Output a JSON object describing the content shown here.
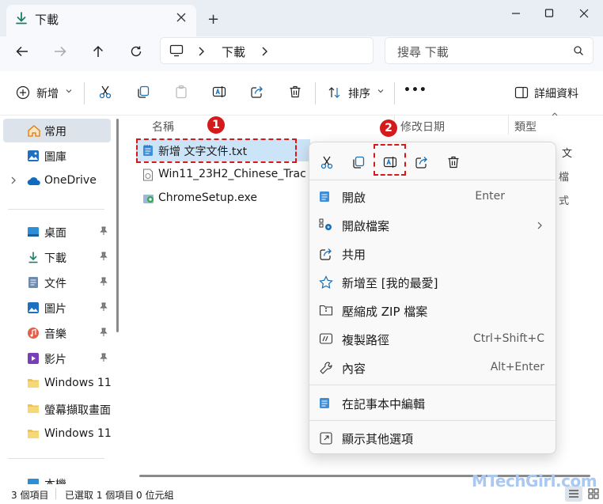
{
  "window": {
    "tab_title": "下載",
    "new_tab_symbol": "+"
  },
  "address_bar": {
    "crumbs": [
      "下載"
    ],
    "search_placeholder": "搜尋 下載"
  },
  "toolbar": {
    "new_label": "新增",
    "sort_label": "排序",
    "more_label": "•••",
    "details_label": "詳細資料"
  },
  "nav": {
    "home": "常用",
    "gallery": "圖庫",
    "onedrive": "OneDrive",
    "desktop": "桌面",
    "downloads": "下載",
    "documents": "文件",
    "pictures": "圖片",
    "music": "音樂",
    "videos": "影片",
    "folder_win11_a": "Windows 11",
    "folder_capture": "螢幕擷取畫面",
    "folder_win11_b": "Windows 11",
    "this_pc": "本機"
  },
  "columns": {
    "name": "名稱",
    "modified": "修改日期",
    "type": "類型"
  },
  "files": [
    {
      "name": "新增 文字文件.txt",
      "icon": "notepad-icon"
    },
    {
      "name": "Win11_23H2_Chinese_Trac",
      "icon": "iso-file-icon"
    },
    {
      "name": "ChromeSetup.exe",
      "icon": "installer-icon"
    }
  ],
  "type_column_fragments": [
    "文",
    "檔",
    "式"
  ],
  "context_menu": {
    "quick_actions": [
      "cut-icon",
      "copy-icon",
      "rename-icon",
      "share-icon",
      "delete-icon"
    ],
    "items": {
      "open": {
        "label": "開啟",
        "shortcut": "Enter"
      },
      "open_with": {
        "label": "開啟檔案"
      },
      "share": {
        "label": "共用"
      },
      "favorites": {
        "label": "新增至 [我的最愛]"
      },
      "zip": {
        "label": "壓縮成 ZIP 檔案"
      },
      "copy_path": {
        "label": "複製路徑",
        "shortcut": "Ctrl+Shift+C"
      },
      "properties": {
        "label": "內容",
        "shortcut": "Alt+Enter"
      },
      "notepad": {
        "label": "在記事本中編輯"
      },
      "more_options": {
        "label": "顯示其他選項"
      }
    }
  },
  "status_bar": {
    "item_count": "3 個項目",
    "selected": "已選取 1 個項目",
    "size": "0 位元組"
  },
  "annotations": {
    "step1": "1",
    "step2": "2"
  },
  "watermark": "MTechGirl.com",
  "colors": {
    "accent": "#0067c0",
    "annotation_red": "#d41a1a",
    "titlebar": "#e9eef5",
    "menu_bg": "#f9f9f9"
  }
}
